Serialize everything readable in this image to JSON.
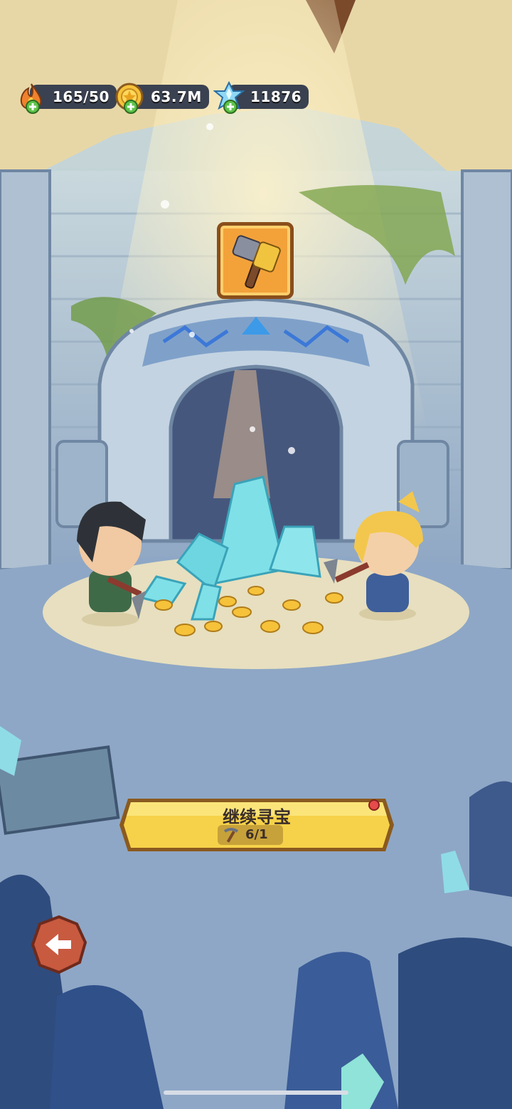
{
  "hud": {
    "stamina": {
      "value": "165/50",
      "icon": "flame-icon"
    },
    "gold": {
      "value": "63.7M",
      "icon": "gold-coin-icon"
    },
    "gems": {
      "value": "11876",
      "icon": "ice-crystal-icon"
    }
  },
  "reward": {
    "icon": "hammer-icon"
  },
  "continue_button": {
    "label": "继续寻宝",
    "cost_icon": "pickaxe-icon",
    "count": "6/1",
    "notification": true
  },
  "back_button": {
    "icon": "back-arrow-icon"
  },
  "colors": {
    "button_yellow": "#f6d24a",
    "button_border": "#8a5a1f",
    "back_red": "#c85a3f",
    "crystal": "#7fe0e8"
  }
}
